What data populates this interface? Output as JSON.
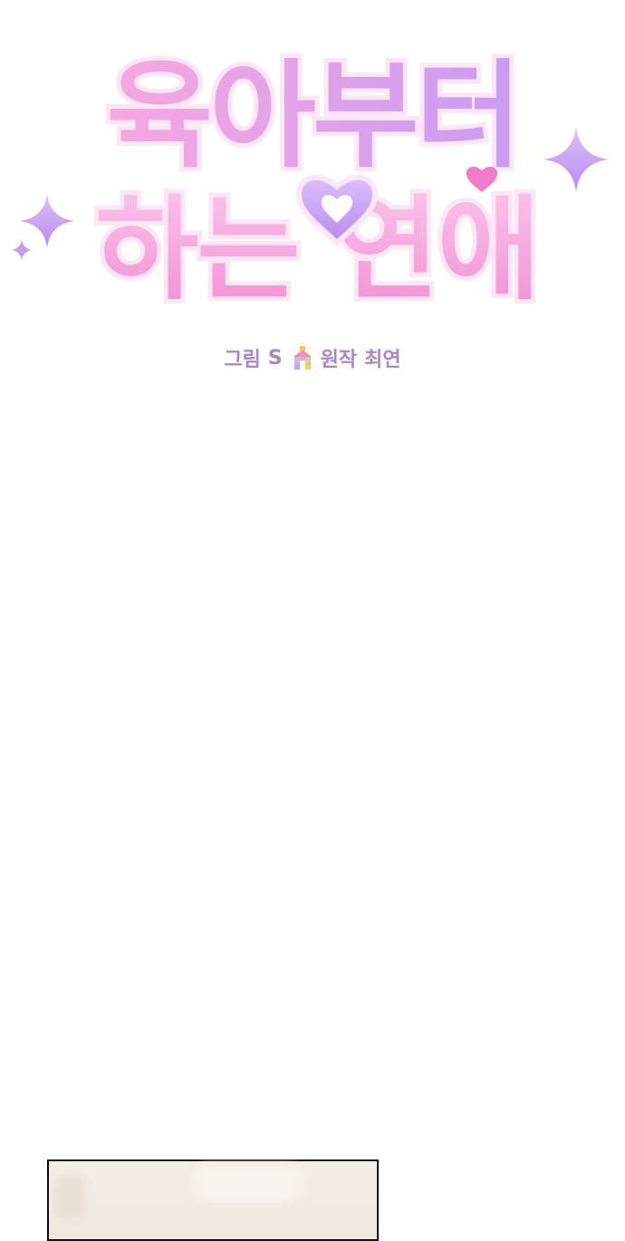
{
  "title": {
    "line1": "육아부터",
    "line2": "하는 연애",
    "colors": {
      "pink": "#f49ad6",
      "pink_light": "#fbc4ea",
      "purple": "#c79bf2",
      "purple_light": "#dcc0fa",
      "outline": "#fde7f6"
    }
  },
  "credits": {
    "artist_label": "그림",
    "artist_name": "S",
    "original_label": "원작",
    "original_author": "최연",
    "color": "#a886c8"
  },
  "decorations": {
    "sparkle_icons": [
      "sparkle-icon",
      "sparkle-icon",
      "sparkle-icon"
    ],
    "heart_icon": "heart-icon",
    "house_icon": "house-icon"
  },
  "panel": {
    "background": "#f1ebe3",
    "border": "#111111"
  }
}
